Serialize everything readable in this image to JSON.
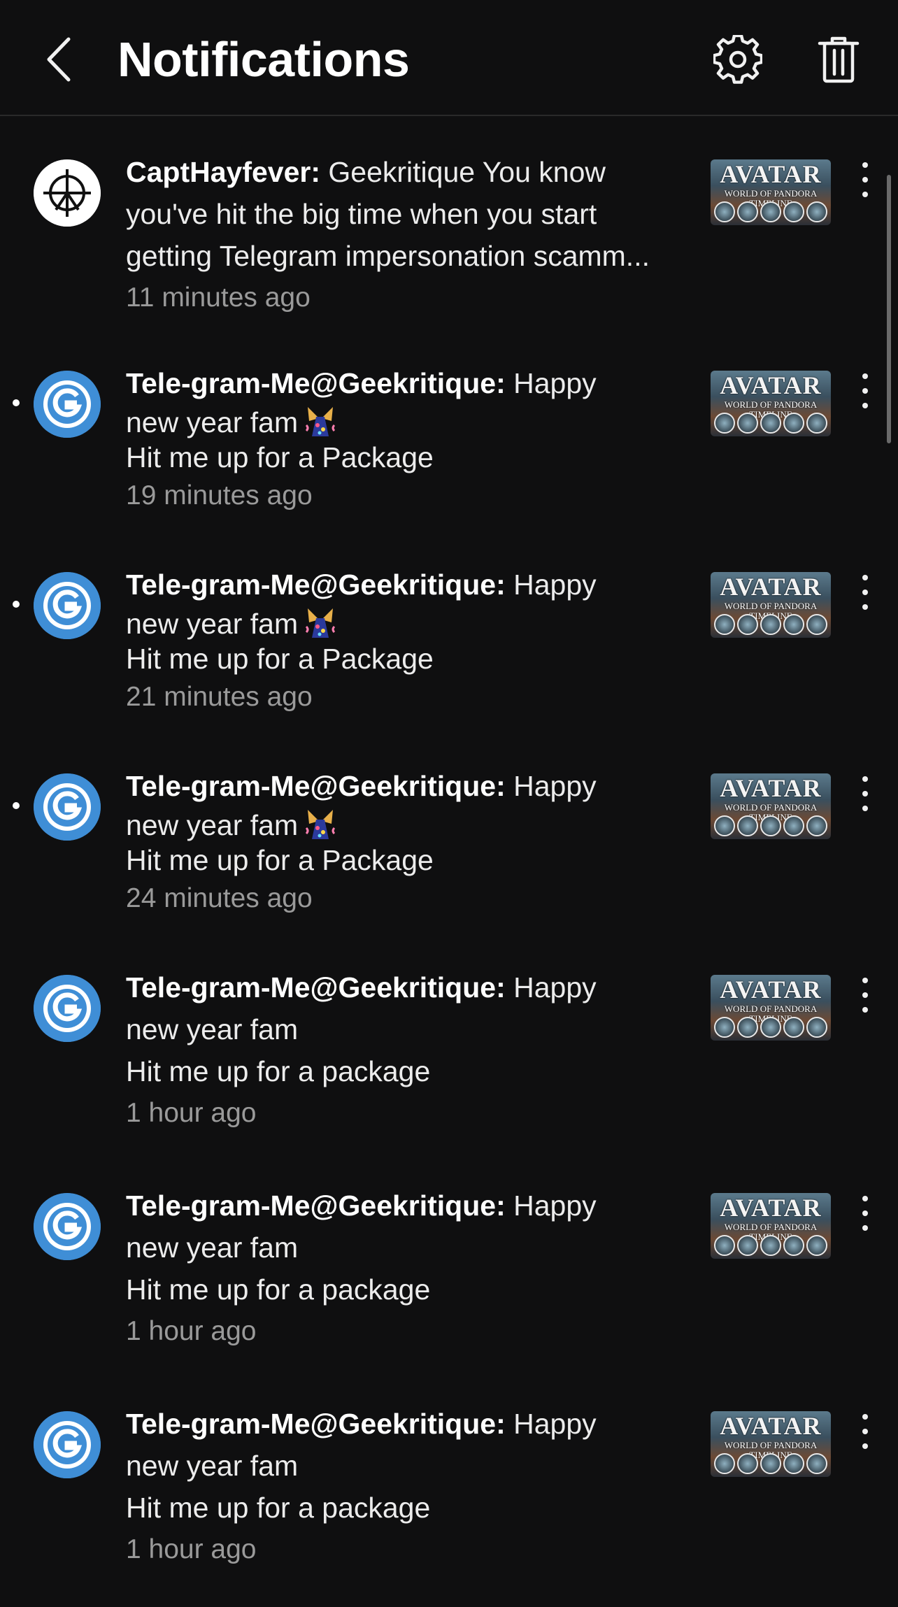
{
  "header": {
    "title": "Notifications",
    "back_icon": "chevron-left-icon",
    "settings_icon": "gear-icon",
    "delete_icon": "trash-icon"
  },
  "thumbnail": {
    "title": "AVATAR",
    "subtitle": "WORLD OF PANDORA TIMELINE"
  },
  "notifications": [
    {
      "author": "CaptHayfever:",
      "lines": [
        "Geekritique You know",
        "you've hit the big time when you start",
        "getting Telegram impersonation scamm..."
      ],
      "time": "11 minutes ago",
      "unread": false,
      "avatar": "crosshair-avatar"
    },
    {
      "author": "Tele-gram-Me@Geekritique:",
      "lines": [
        "Happy",
        "new year fam",
        "Hit me up for a Package"
      ],
      "time": "19 minutes ago",
      "unread": true,
      "emoji": "party-popper-icon",
      "avatar": "geekritique-avatar"
    },
    {
      "author": "Tele-gram-Me@Geekritique:",
      "lines": [
        "Happy",
        "new year fam",
        "Hit me up for a Package"
      ],
      "time": "21 minutes ago",
      "unread": true,
      "emoji": "party-popper-icon",
      "avatar": "geekritique-avatar"
    },
    {
      "author": "Tele-gram-Me@Geekritique:",
      "lines": [
        "Happy",
        "new year fam",
        "Hit me up for a Package"
      ],
      "time": "24 minutes ago",
      "unread": true,
      "emoji": "party-popper-icon",
      "avatar": "geekritique-avatar"
    },
    {
      "author": "Tele-gram-Me@Geekritique:",
      "lines": [
        "Happy",
        "new year fam",
        "Hit me up for a package"
      ],
      "time": "1 hour ago",
      "unread": false,
      "avatar": "geekritique-avatar"
    },
    {
      "author": "Tele-gram-Me@Geekritique:",
      "lines": [
        "Happy",
        "new year fam",
        "Hit me up for a package"
      ],
      "time": "1 hour ago",
      "unread": false,
      "avatar": "geekritique-avatar"
    },
    {
      "author": "Tele-gram-Me@Geekritique:",
      "lines": [
        "Happy",
        "new year fam",
        "Hit me up for a package"
      ],
      "time": "1 hour ago",
      "unread": false,
      "avatar": "geekritique-avatar"
    }
  ]
}
